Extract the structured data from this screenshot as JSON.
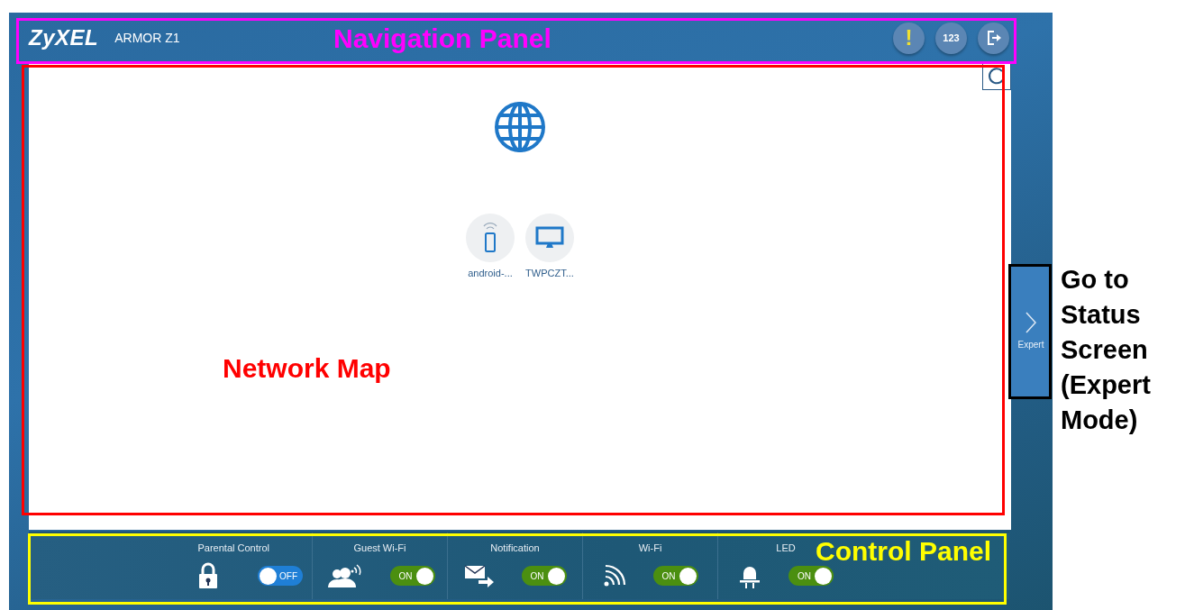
{
  "header": {
    "logo": "ZyXEL",
    "model": "ARMOR Z1",
    "buttons": [
      {
        "kind": "alert",
        "label": "!"
      },
      {
        "kind": "count",
        "label": "123"
      },
      {
        "kind": "logout"
      }
    ]
  },
  "map": {
    "devices": [
      {
        "kind": "phone",
        "name": "android-..."
      },
      {
        "kind": "monitor",
        "name": "TWPCZT..."
      }
    ]
  },
  "expert_tab": {
    "label": "Expert"
  },
  "controls": [
    {
      "kind": "lock",
      "label": "Parental Control",
      "on": false,
      "state": "OFF"
    },
    {
      "kind": "guest",
      "label": "Guest Wi-Fi",
      "on": true,
      "state": "ON"
    },
    {
      "kind": "mail",
      "label": "Notification",
      "on": true,
      "state": "ON"
    },
    {
      "kind": "wifi",
      "label": "Wi-Fi",
      "on": true,
      "state": "ON"
    },
    {
      "kind": "led",
      "label": "LED",
      "on": true,
      "state": "ON"
    }
  ],
  "annotations": [
    {
      "kind": "navigation",
      "text": "Navigation Panel"
    },
    {
      "kind": "map",
      "text": "Network Map"
    },
    {
      "kind": "control",
      "text": "Control Panel"
    },
    {
      "kind": "expert",
      "text": "Go to Status Screen (Expert Mode)"
    }
  ]
}
